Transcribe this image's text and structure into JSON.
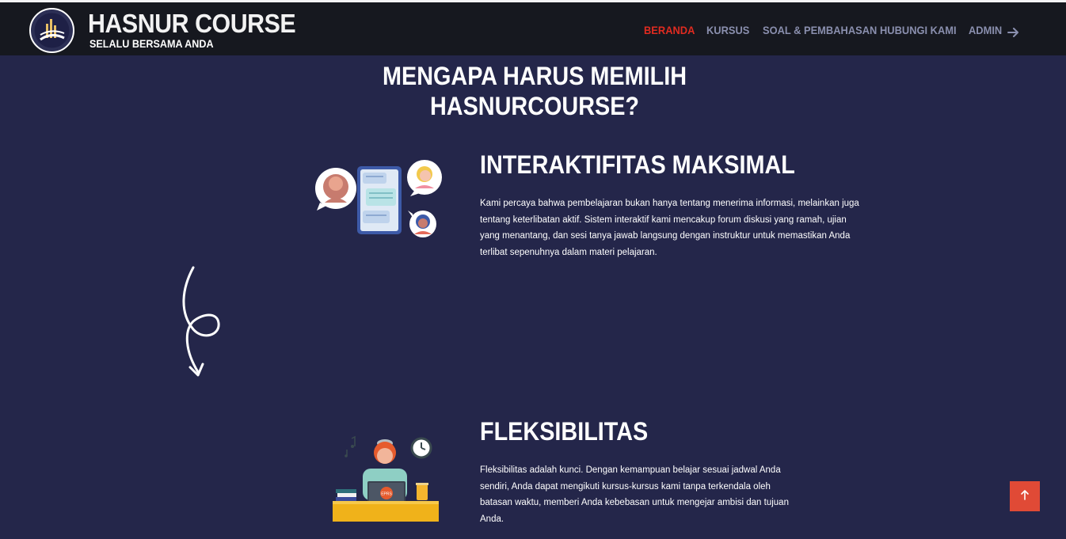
{
  "header": {
    "brand_title": "HASNUR COURSE",
    "brand_subtitle": "SELALU BERSAMA ANDA",
    "logo_icon": "hasnur-logo-icon",
    "nav": [
      {
        "label": "BERANDA",
        "active": true
      },
      {
        "label": "KURSUS",
        "active": false
      },
      {
        "label": "SOAL & PEMBAHASAN",
        "active": false
      },
      {
        "label": "HUBUNGI KAMI",
        "active": false
      },
      {
        "label": "ADMIN",
        "active": false
      }
    ],
    "nav_arrow_icon": "arrow-right-icon"
  },
  "section": {
    "title_line1": "MENGAPA HARUS MEMILIH",
    "title_line2": "HASNURCOURSE?"
  },
  "features": [
    {
      "title": "INTERAKTIFITAS MAKSIMAL",
      "text": "Kami percaya bahwa pembelajaran bukan hanya tentang menerima informasi, melainkan juga tentang keterlibatan aktif. Sistem interaktif kami mencakup forum diskusi yang ramah, ujian yang menantang, dan sesi tanya jawab langsung dengan instruktur untuk memastikan Anda terlibat sepenuhnya dalam materi pelajaran.",
      "icon": "chat-people-illustration"
    },
    {
      "title": "FLEKSIBILITAS",
      "text": "Fleksibilitas adalah kunci. Dengan kemampuan belajar sesuai jadwal Anda sendiri, Anda dapat mengikuti kursus-kursus kami tanpa terkendala oleh batasan waktu, memberi Anda kebebasan untuk mengejar ambisi dan tujuan Anda.",
      "icon": "student-laptop-illustration",
      "laptop_label": "EPRS"
    }
  ],
  "decor": {
    "arrow_icon": "curly-arrow-icon"
  },
  "scroll_top": {
    "icon": "arrow-up-icon"
  },
  "colors": {
    "background": "#24264a",
    "navbar": "#16181f",
    "active_nav": "#e02b20",
    "nav_text": "#8a8fae",
    "scroll_button": "#e04a36"
  }
}
